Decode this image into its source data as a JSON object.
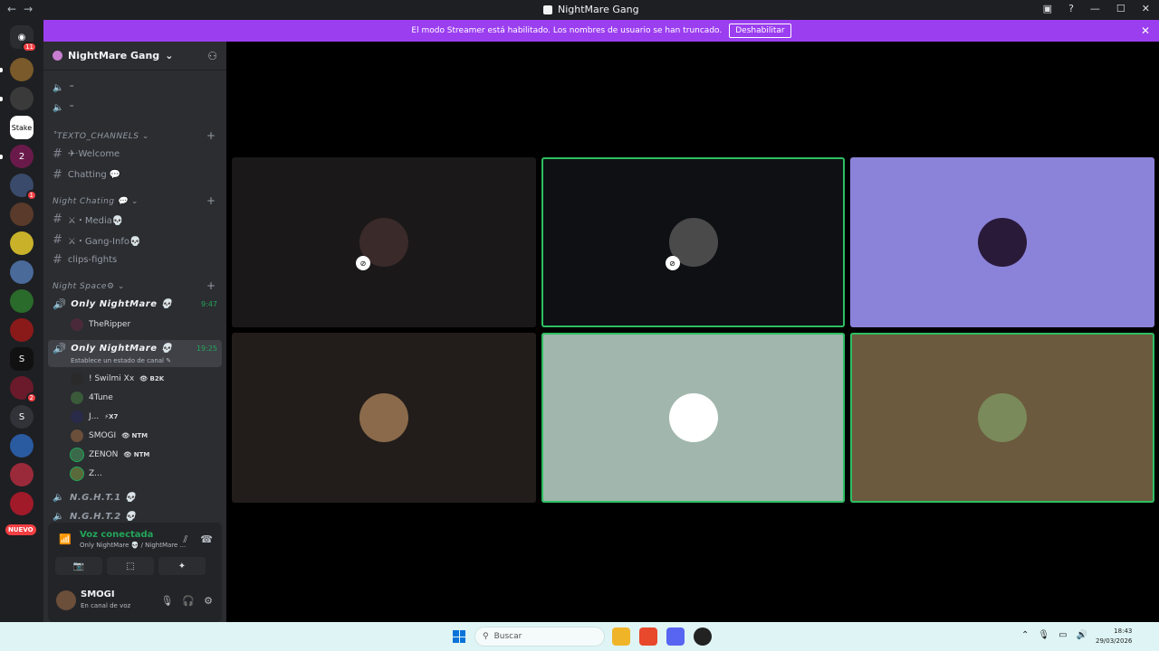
{
  "titlebar": {
    "back": "←",
    "forward": "→",
    "title": "NightMare Gang",
    "icons": [
      "inbox-icon",
      "help-icon",
      "minimize-icon",
      "maximize-icon",
      "close-icon"
    ],
    "glyphs": [
      "▣",
      "?",
      "—",
      "☐",
      "✕"
    ]
  },
  "banner": {
    "text": "El modo Streamer está habilitado. Los nombres de usuario se han truncado.",
    "button": "Deshabilitar",
    "close": "✕",
    "color": "#9b3ef0"
  },
  "servers": {
    "home_badge": "11",
    "badges": [
      "2",
      "1",
      "2"
    ],
    "letter_server": "S",
    "nuevo": "NUEVO"
  },
  "guild": {
    "name": "NightMare Gang",
    "chevron": "⌄"
  },
  "channels": {
    "voice_top": [
      "⁼",
      "⁼"
    ],
    "cat1": {
      "name": "˚TEXTO_CHANNELS ⌄",
      "items": [
        "✈·Welcome",
        "Chatting 💬"
      ]
    },
    "cat2": {
      "name": "Night Chating 💬 ⌄",
      "items": [
        "⚔・Media💀",
        "⚔・Gang-Info💀",
        "clips-fights"
      ]
    },
    "cat3": {
      "name": "Night Space⚙ ⌄"
    },
    "vc1": {
      "name": "Only NightMare 💀",
      "time": "9:47",
      "members": [
        {
          "name": "TheRipper",
          "tag": ""
        }
      ]
    },
    "vc2": {
      "name": "Only NightMare 💀",
      "time": "19:25",
      "status": "Establece un estado de canal ✎",
      "members": [
        {
          "name": "! Swilmi Xx",
          "tag": "👁 B2K"
        },
        {
          "name": "4Tune",
          "tag": ""
        },
        {
          "name": "J...",
          "tag": "⚡X7"
        },
        {
          "name": "SMOGI",
          "tag": "👁 NTM"
        },
        {
          "name": "ZENON",
          "tag": "👁 NTM"
        },
        {
          "name": "Z...",
          "tag": ""
        }
      ]
    },
    "vc3": {
      "name": "N.G.H.T.1 💀"
    },
    "vc4": {
      "name": "N.G.H.T.2 💀"
    }
  },
  "voice_panel": {
    "title": "Voz conectada",
    "sub": "Only NightMare 💀 / NightMare ...",
    "buttons": [
      "📷",
      "⬚",
      "✦",
      "✺"
    ]
  },
  "user": {
    "name": "SMOGI",
    "status": "En canal de voz"
  },
  "tiles": [
    {
      "bg": "#1a1818",
      "speaking": false,
      "avatar": "#3a2a2a",
      "muted": true
    },
    {
      "bg": "#0e1014",
      "speaking": true,
      "avatar": "#4a4a4a",
      "muted": true
    },
    {
      "bg": "#8b83d9",
      "speaking": false,
      "avatar": "#2a1a3a",
      "muted": false
    },
    {
      "bg": "#221d1b",
      "speaking": false,
      "avatar": "#8a6a4a",
      "muted": false
    },
    {
      "bg": "#a1b7ad",
      "speaking": true,
      "avatar": "#ffffff",
      "muted": false
    },
    {
      "bg": "#6b5a3e",
      "speaking": true,
      "avatar": "#7a8a5a",
      "muted": false
    }
  ],
  "taskbar": {
    "search": "Buscar",
    "time": "18:43",
    "date": "29/03/2026"
  }
}
